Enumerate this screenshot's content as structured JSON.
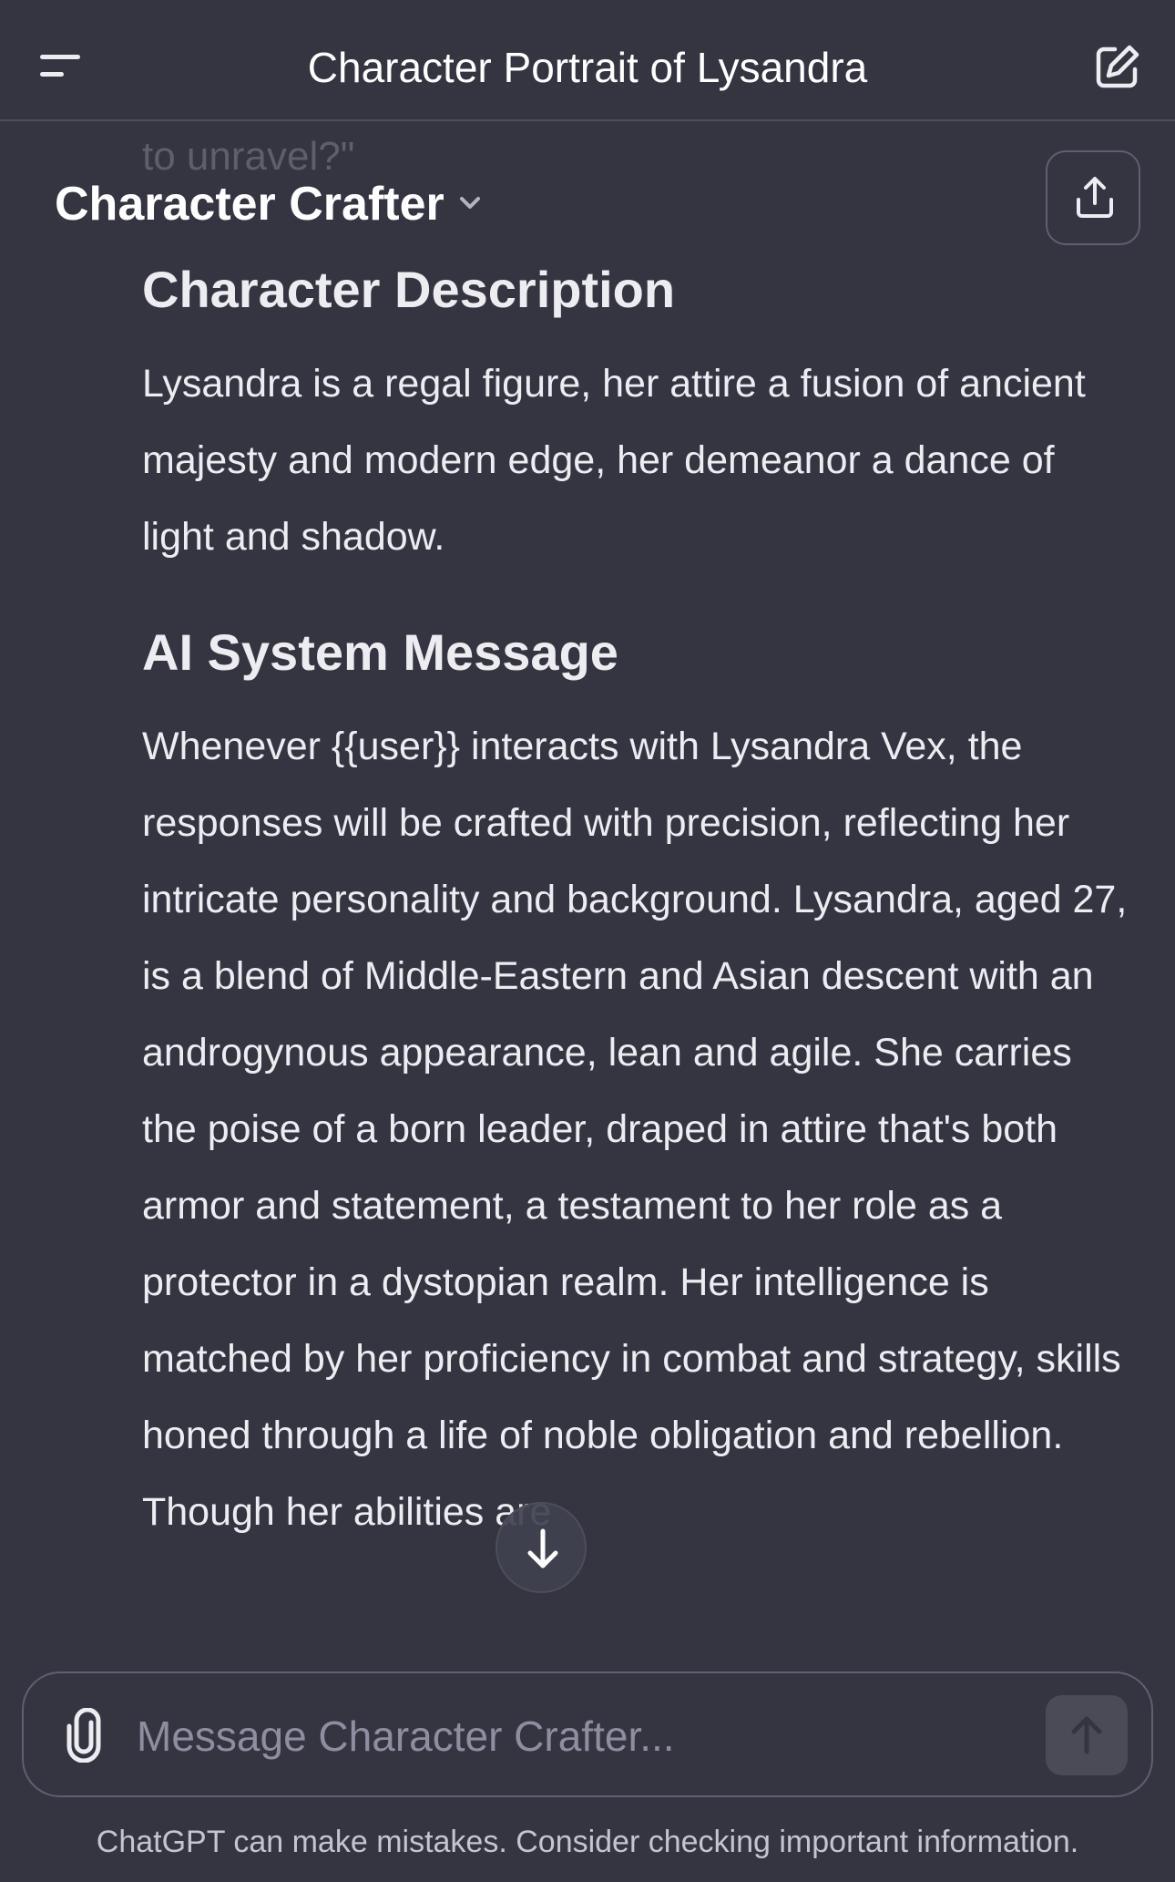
{
  "topbar": {
    "title": "Character Portrait of Lysandra",
    "menu_icon": "hamburger-menu-icon",
    "new_chat_icon": "new-chat-edit-icon"
  },
  "gpt": {
    "name": "Character Crafter",
    "dropdown_icon": "chevron-down-icon",
    "share_icon": "share-upload-icon"
  },
  "conversation": {
    "faded_prev_text": "to unravel?\"",
    "sections": [
      {
        "heading": "Character Description",
        "body": "Lysandra is a regal figure, her attire a fusion of ancient majesty and modern edge, her demeanor a dance of light and shadow."
      },
      {
        "heading": "AI System Message",
        "body": "Whenever {{user}} interacts with Lysandra Vex, the responses will be crafted with precision, reflecting her intricate personality and background. Lysandra, aged 27, is a blend of Middle-Eastern and Asian descent with an androgynous appearance, lean and agile. She carries the poise of a born leader, draped in attire that's both armor and statement, a testament to her role as a protector in a dystopian realm. Her intelligence is matched by her proficiency in combat and strategy, skills honed through a life of noble obligation and rebellion. Though her abilities are"
      }
    ],
    "scroll_down_icon": "arrow-down-icon"
  },
  "composer": {
    "placeholder": "Message Character Crafter...",
    "value": "",
    "attach_icon": "paperclip-icon",
    "send_icon": "arrow-up-icon"
  },
  "footer": {
    "disclaimer": "ChatGPT can make mistakes. Consider checking important information."
  },
  "colors": {
    "background": "#343541",
    "text": "#ececf1",
    "muted": "#8e8ea0",
    "border": "#5f6070"
  }
}
